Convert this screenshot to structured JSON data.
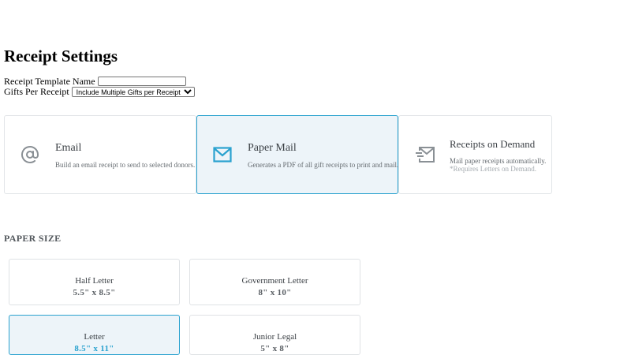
{
  "page": {
    "title": "Receipt Settings"
  },
  "form": {
    "template_name_label": "Receipt Template Name",
    "template_name_value": "",
    "gifts_label": "Gifts Per Receipt",
    "gifts_selected": "Include Multiple Gifts per Receipt"
  },
  "delivery": [
    {
      "title": "Email",
      "description": "Build an email receipt to send to selected donors.",
      "icon": "at-sign-icon",
      "selected": false
    },
    {
      "title": "Paper Mail",
      "description": "Generates a PDF of all gift receipts to print and mail.",
      "icon": "envelope-icon",
      "selected": true
    },
    {
      "title": "Receipts on Demand",
      "description": "Mail paper receipts automatically.",
      "note": "*Requires Letters on Demand.",
      "icon": "send-mail-icon",
      "selected": false
    }
  ],
  "paper_size": {
    "label": "PAPER SIZE",
    "options": [
      {
        "name": "Half Letter",
        "dims": "5.5\" x 8.5\"",
        "selected": false
      },
      {
        "name": "Government Letter",
        "dims": "8\" x 10\"",
        "selected": false
      },
      {
        "name": "Letter",
        "dims": "8.5\" x 11\"",
        "selected": true
      },
      {
        "name": "Junior Legal",
        "dims": "5\" x 8\"",
        "selected": false
      }
    ]
  },
  "colors": {
    "accent": "#2aa2cf",
    "selected_bg": "#edf4f9",
    "icon_gray": "#8a9095"
  }
}
